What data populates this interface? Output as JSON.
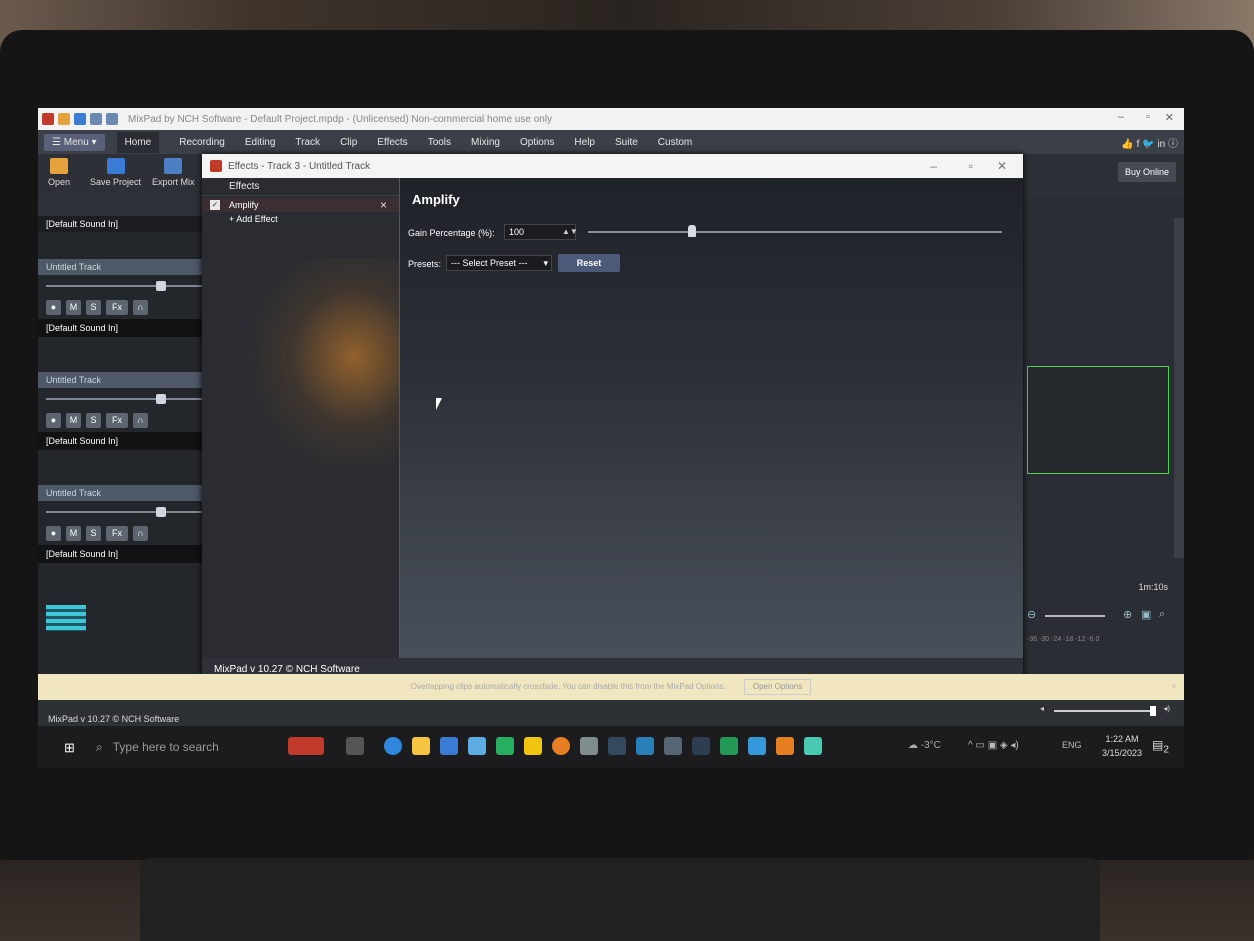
{
  "window": {
    "title": "MixPad by NCH Software - Default Project.mpdp - (Unlicensed) Non-commercial home use only"
  },
  "menubar": {
    "menu_label": "☰ Menu ▾",
    "items": [
      "Home",
      "Recording",
      "Editing",
      "Track",
      "Clip",
      "Effects",
      "Tools",
      "Mixing",
      "Options",
      "Help",
      "Suite",
      "Custom"
    ]
  },
  "toolbar": {
    "open": "Open",
    "save_project": "Save Project",
    "export_mix": "Export Mix",
    "buy_online": "Buy Online"
  },
  "tracks": {
    "sound_in_top": "[Default Sound In]",
    "items": [
      {
        "name": "Untitled Track",
        "sound_in": "[Default Sound In]"
      },
      {
        "name": "Untitled Track",
        "sound_in": "[Default Sound In]"
      },
      {
        "name": "Untitled Track",
        "sound_in": "[Default Sound In]"
      }
    ],
    "buttons": {
      "mute": "M",
      "solo": "S",
      "fx": "Fx"
    }
  },
  "effects_dialog": {
    "title": "Effects - Track 3 - Untitled Track",
    "list_header": "Effects",
    "effect_name": "Amplify",
    "add_effect": "+ Add Effect",
    "panel_title": "Amplify",
    "gain_label": "Gain Percentage (%):",
    "gain_value": "100",
    "gain_level": 0.25,
    "presets_label": "Presets:",
    "presets_value": "--- Select Preset ---",
    "reset_label": "Reset",
    "status": "MixPad v 10.27 © NCH Software"
  },
  "timeline": {
    "time_mark": "1m:10s",
    "meter_ticks": "-36  -30  -24  -18  -12  -6  0"
  },
  "notice": {
    "text": "Overlapping clips automatically crossfade. You can disable this from the MixPad Options.",
    "button": "Open Options"
  },
  "status": {
    "version": "MixPad v 10.27 © NCH Software"
  },
  "taskbar": {
    "search_placeholder": "Type here to search",
    "weather": "-3°C",
    "language": "ENG",
    "time": "1:22 AM",
    "date": "3/15/2023",
    "notification_count": "2"
  },
  "colors": {
    "accent": "#4a5a78",
    "clip_border": "#4bd14b",
    "notice_bg": "#f0e6c0"
  }
}
